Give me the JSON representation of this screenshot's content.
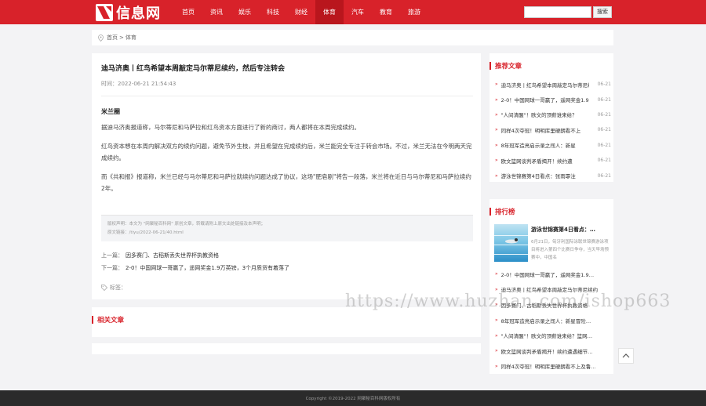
{
  "header": {
    "logo_text": "信息网",
    "nav": [
      "首页",
      "资讯",
      "娱乐",
      "科技",
      "财经",
      "体育",
      "汽车",
      "教育",
      "旅游"
    ],
    "active_nav": "体育",
    "search_placeholder": "",
    "search_button": "搜索",
    "accent_color": "#d8222a"
  },
  "breadcrumb": {
    "home": "首页",
    "separator": ">",
    "current": "体育"
  },
  "article": {
    "title": "迪马济奥丨红鸟希望本周敲定马尔蒂尼续约，然后专注转会",
    "time": "时间：2022-06-21 21:54:43",
    "subheading": "米兰圈",
    "paragraphs": [
      "据迪马济奥报道称，马尔蒂尼和马萨拉和红鸟资本方面进行了新的商讨，两人都将在本周完成续约。",
      "红鸟资本想在本周内解决双方的续约问题，避免节外生枝，并且希望在完成续约后，米兰能完全专注于转会市场。不过，米兰无法在今明两天完成续约。",
      "而《共和报》报道称，米兰已经与马尔蒂尼和马萨拉就续约问题达成了协议，这场\"肥皂剧\"将告一段落，米兰将在近日与马尔蒂尼和马萨拉续约2年。"
    ],
    "notice_line1": "版权声明：本文为 \"网聚秘百科网\" 原创文章，转载请附上原文出处链接及本声明；",
    "notice_line2": "原文链接：/tiyu/2022-06-21/40.html",
    "prev_label": "上一篇：",
    "prev_title": "因多赛门、古稻斯丢失世界杯执教资格",
    "next_label": "下一篇：",
    "next_title": "2-0！中国网球一哥赢了，遥网奖金1.9万英镑，3个月质货有着落了",
    "tags_label": "标签："
  },
  "related": {
    "heading": "相关文章"
  },
  "recommend": {
    "heading": "推荐文章",
    "items": [
      {
        "title": "迪马济奥丨红鸟希望本周敲定马尔蒂尼续约",
        "date": "06-21"
      },
      {
        "title": "2-0！中国网球一哥赢了，遥网奖金1.9万英镑",
        "date": "06-21"
      },
      {
        "title": "\"人间清醒\"！欧文的顶薪谁来给？",
        "date": "06-21"
      },
      {
        "title": "同样4次夺冠！明明库里硬朗看不上",
        "date": "06-21"
      },
      {
        "title": "8年冠军造亮启示录之闯人：新星",
        "date": "06-21"
      },
      {
        "title": "欧文篮网谈判矛盾揭开！续约遭",
        "date": "06-21"
      },
      {
        "title": "游泳世锦赛第4日看点：张雨霏注",
        "date": "06-21"
      }
    ]
  },
  "ranking": {
    "heading": "排行榜",
    "feature_title": "游泳世锦赛第4日看点：…",
    "feature_desc": "6月21日，匈牙利国际泳联世锦赛游泳项目将进入第四个比赛日争夺，当天早场预赛中，中国名",
    "items": [
      "2-0！中国网球一哥赢了，遥网奖金1.9…",
      "迪马济奥丨红鸟希望本周敲定马尔蒂尼续约",
      "因多赛门、古稻斯丢失世界杯执教资格",
      "8年冠军造亮启示录之闯人：新星冒险…",
      "\"人间清醒\"！欧文的顶薪谁来给？篮网…",
      "欧文篮网谈判矛盾揭开！续约遭遇细节…",
      "同样4次夺冠！明明库里硬朗看不上及鲁…"
    ]
  },
  "footer": {
    "copyright": "Copyright ©2019-2022 网聚秘百科网版权所有"
  },
  "watermark": "https://www.huzhan.com/ishop663"
}
